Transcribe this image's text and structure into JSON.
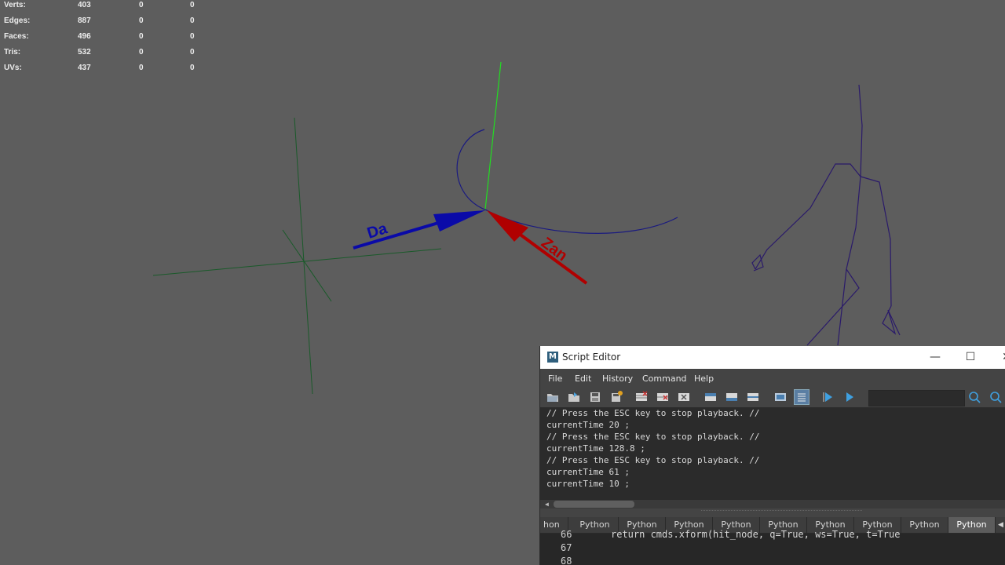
{
  "hud": {
    "rows": [
      {
        "label": "Verts:",
        "v1": "403",
        "v2": "0",
        "v3": "0"
      },
      {
        "label": "Edges:",
        "v1": "887",
        "v2": "0",
        "v3": "0"
      },
      {
        "label": "Faces:",
        "v1": "496",
        "v2": "0",
        "v3": "0"
      },
      {
        "label": "Tris:",
        "v1": "532",
        "v2": "0",
        "v3": "0"
      },
      {
        "label": "UVs:",
        "v1": "437",
        "v2": "0",
        "v3": "0"
      }
    ]
  },
  "viewport": {
    "arrow_blue_label": "Da",
    "arrow_red_label": "Zan",
    "colors": {
      "background": "#5d5d5d",
      "grid": "#1a5a2a",
      "y_axis": "#22dd22",
      "curve": "#1a1a80",
      "blue_arrow": "#0a0aa8",
      "red_arrow": "#b00000",
      "skeleton": "#2a1a6a"
    }
  },
  "script_editor": {
    "title": "Script Editor",
    "logo": "M",
    "window_buttons": {
      "minimize": "—",
      "maximize": "☐",
      "close": "✕"
    },
    "menu": [
      "File",
      "Edit",
      "History",
      "Command",
      "Help"
    ],
    "toolbar_icons": [
      "open-script-icon",
      "source-script-icon",
      "save-script-icon",
      "save-script-to-shelf-icon",
      "clear-history-icon",
      "clear-input-icon",
      "clear-all-icon",
      "show-history-icon",
      "show-input-icon",
      "show-both-icon",
      "echo-all-commands-icon",
      "show-line-numbers-icon",
      "execute-selected-icon",
      "execute-all-icon",
      "search-icon",
      "search-next-icon"
    ],
    "search_value": "",
    "output_lines": [
      "// Press the ESC key to stop playback. //",
      "currentTime 20 ;",
      "// Press the ESC key to stop playback. //",
      "currentTime 128.8 ;",
      "// Press the ESC key to stop playback. //",
      "currentTime 61 ;",
      "currentTime 10 ;"
    ],
    "tabs": [
      "hon",
      "Python",
      "Python",
      "Python",
      "Python",
      "Python",
      "Python",
      "Python",
      "Python",
      "Python"
    ],
    "active_tab_index": 9,
    "tab_scroll_arrow": "◀",
    "code": {
      "line_numbers": [
        "66",
        "67",
        "68"
      ],
      "line_66": "return cmds.xform(hit_node, q=True, ws=True, t=True"
    }
  }
}
